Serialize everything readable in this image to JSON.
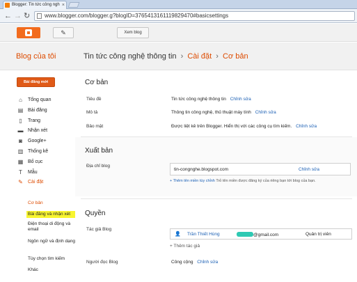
{
  "browser": {
    "tab_title": "Blogger: Tin tức công ngh",
    "tab_close": "×",
    "url": "www.blogger.com/blogger.g?blogID=3765413161119829470#basicsettings"
  },
  "header": {
    "view_blog_label": "Xem blog"
  },
  "titlebar": {
    "my_blogs": "Blog của tôi",
    "blog_name": "Tin tức công nghệ thông tin",
    "sep1": "›",
    "settings": "Cài đặt",
    "sep2": "›",
    "current": "Cơ bản"
  },
  "sidebar": {
    "new_post": "Bài đăng mới",
    "items": [
      {
        "label": "Tổng quan",
        "icon": "home-icon",
        "glyph": "⌂"
      },
      {
        "label": "Bài đăng",
        "icon": "posts-icon",
        "glyph": "▤"
      },
      {
        "label": "Trang",
        "icon": "pages-icon",
        "glyph": "▯"
      },
      {
        "label": "Nhận xét",
        "icon": "comments-icon",
        "glyph": "▬"
      },
      {
        "label": "Google+",
        "icon": "google-plus-icon",
        "glyph": "◙"
      },
      {
        "label": "Thống kê",
        "icon": "stats-icon",
        "glyph": "▥"
      },
      {
        "label": "Bố cục",
        "icon": "layout-icon",
        "glyph": "▦"
      },
      {
        "label": "Mẫu",
        "icon": "template-icon",
        "glyph": "T"
      },
      {
        "label": "Cài đặt",
        "icon": "wrench-icon",
        "glyph": "✎"
      }
    ],
    "subitems": [
      "Cơ bản",
      "Bài đăng và nhận xét",
      "Điện thoại di động và email",
      "Ngôn ngữ và định dạng",
      "Tùy chọn tìm kiếm",
      "Khác"
    ]
  },
  "main": {
    "basics": {
      "heading": "Cơ bản",
      "rows": [
        {
          "label": "Tiêu đề",
          "value": "Tin tức công nghệ thông tin",
          "action": "Chỉnh sửa"
        },
        {
          "label": "Mô tả",
          "value": "Thông tin công nghệ, thủ thuật máy tính",
          "action": "Chỉnh sửa"
        },
        {
          "label": "Bảo mật",
          "value": "Được liệt kê trên Blogger. Hiển thị với các công cụ tìm kiếm.",
          "action": "Chỉnh sửa"
        }
      ]
    },
    "publishing": {
      "heading": "Xuất bản",
      "label": "Địa chỉ blog",
      "address": "tin-congnghe.blogspot.com",
      "action": "Chỉnh sửa",
      "note_link": "+ Thêm tên miền tùy chỉnh",
      "note_text": "Trỏ tên miền được đăng ký của riêng bạn tới blog của bạn."
    },
    "permissions": {
      "heading": "Quyền",
      "authors_label": "Tác giả Blog",
      "author_name": "Trần Thiết Hùng",
      "author_email_suffix": "@gmail.com",
      "author_role": "Quản trị viên",
      "add_author": "+ Thêm tác giả",
      "readers_label": "Người đọc Blog",
      "readers_value": "Công cộng",
      "readers_action": "Chỉnh sửa"
    }
  },
  "colors": {
    "accent": "#dd4b00",
    "link": "#1a5fb4",
    "highlight": "#f8f530"
  }
}
